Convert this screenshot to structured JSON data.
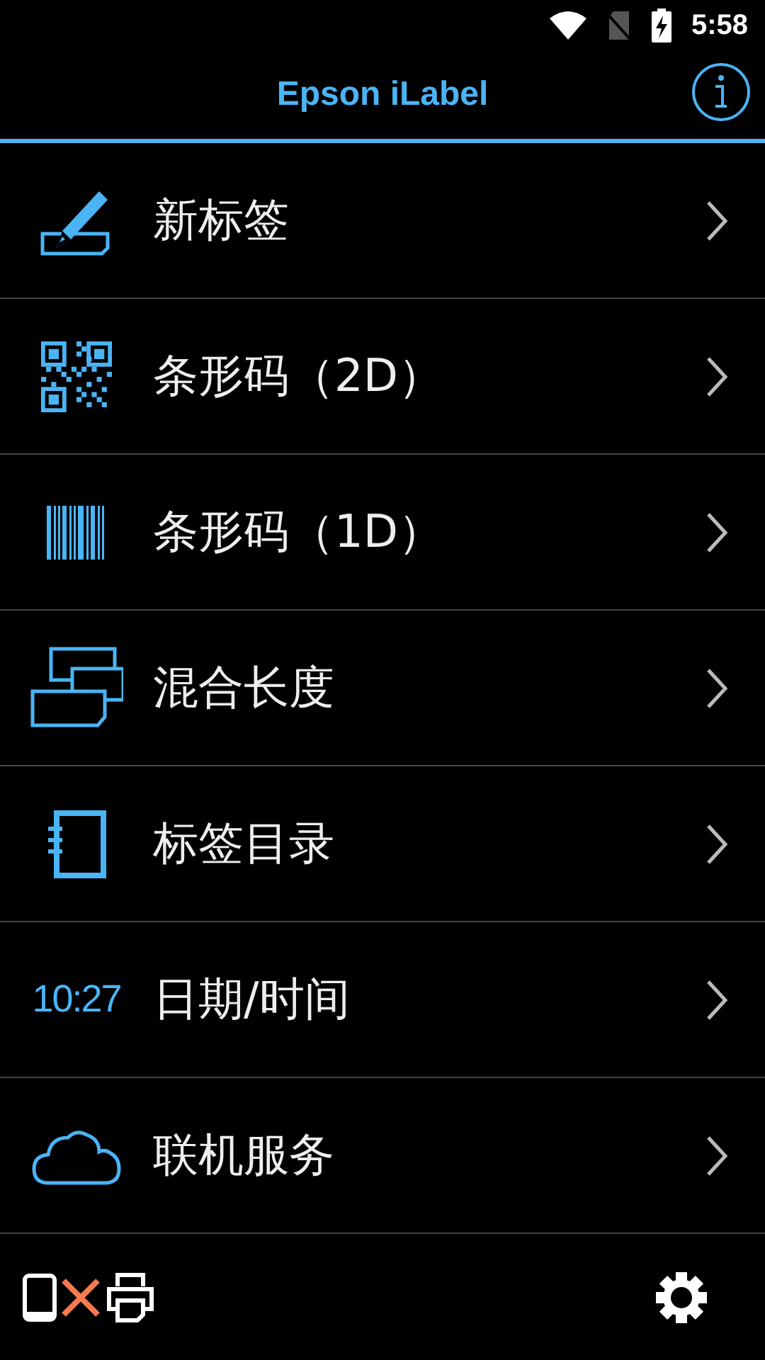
{
  "status_bar": {
    "time": "5:58"
  },
  "header": {
    "title": "Epson iLabel"
  },
  "menu": [
    {
      "kind": "pencil",
      "label": "新标签"
    },
    {
      "kind": "qr",
      "label": "条形码（2D）"
    },
    {
      "kind": "barcode",
      "label": "条形码（1D）"
    },
    {
      "kind": "stack",
      "label": "混合长度"
    },
    {
      "kind": "notebook",
      "label": "标签目录"
    },
    {
      "kind": "time",
      "icon_text": "10:27",
      "label": "日期/时间"
    },
    {
      "kind": "cloud",
      "label": "联机服务"
    }
  ],
  "footer": {
    "printer_connected": false
  }
}
